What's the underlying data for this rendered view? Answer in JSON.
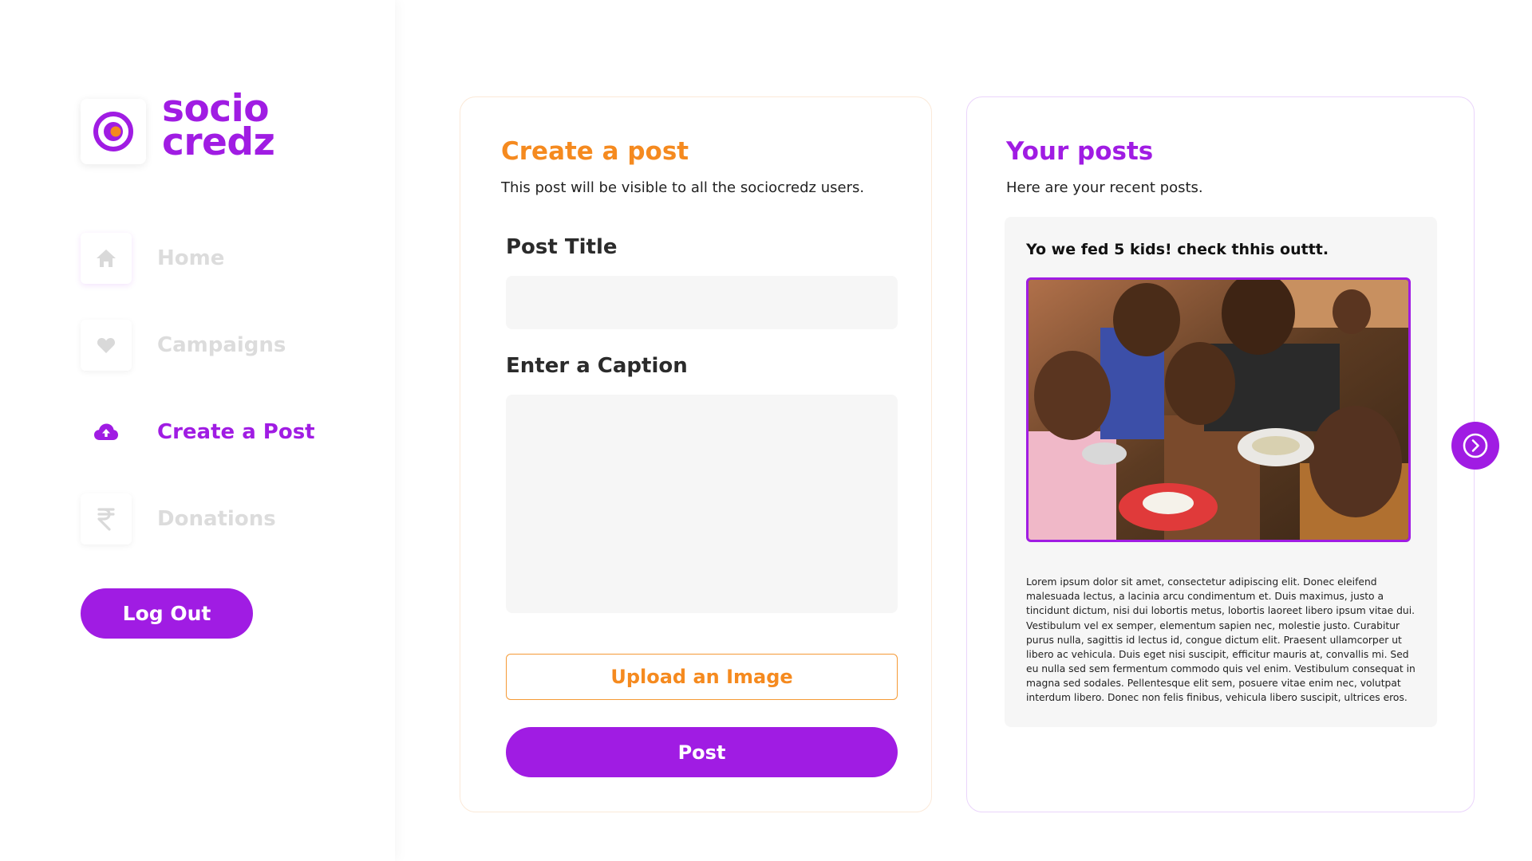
{
  "brand": {
    "line1": "socio",
    "line2": "credz",
    "primary_color": "#a01ce3",
    "accent_color": "#f58a1f"
  },
  "sidebar": {
    "items": [
      {
        "label": "Home",
        "icon": "home-icon",
        "active": false
      },
      {
        "label": "Campaigns",
        "icon": "heart-icon",
        "active": false
      },
      {
        "label": "Create a Post",
        "icon": "cloud-upload-icon",
        "active": true
      },
      {
        "label": "Donations",
        "icon": "rupee-icon",
        "active": false
      }
    ],
    "logout_label": "Log Out"
  },
  "create_post": {
    "title": "Create a post",
    "subtitle": "This post will be visible to all the sociocredz users.",
    "post_title_label": "Post Title",
    "post_title_value": "",
    "caption_label": "Enter a Caption",
    "caption_value": "",
    "upload_label": "Upload an Image",
    "post_label": "Post"
  },
  "your_posts": {
    "title": "Your posts",
    "subtitle": "Here are your recent posts.",
    "posts": [
      {
        "title": "Yo we fed 5 kids! check thhis outtt.",
        "image_alt": "children-eating-photo",
        "body": "Lorem ipsum dolor sit amet, consectetur adipiscing elit. Donec eleifend malesuada lectus, a lacinia arcu condimentum et. Duis maximus, justo a tincidunt dictum, nisi dui lobortis metus, lobortis laoreet libero ipsum vitae dui. Vestibulum vel ex semper, elementum sapien nec, molestie justo. Curabitur purus nulla, sagittis id lectus id, congue dictum elit. Praesent ullamcorper ut libero ac vehicula. Duis eget nisi suscipit, efficitur mauris at, convallis mi. Sed eu nulla sed sem fermentum commodo quis vel enim. Vestibulum consequat in magna sed sodales. Pellentesque elit sem, posuere vitae enim nec, volutpat interdum libero. Donec non felis finibus, vehicula libero suscipit, ultrices eros."
      }
    ],
    "next_icon": "chevron-right-circle-icon"
  }
}
